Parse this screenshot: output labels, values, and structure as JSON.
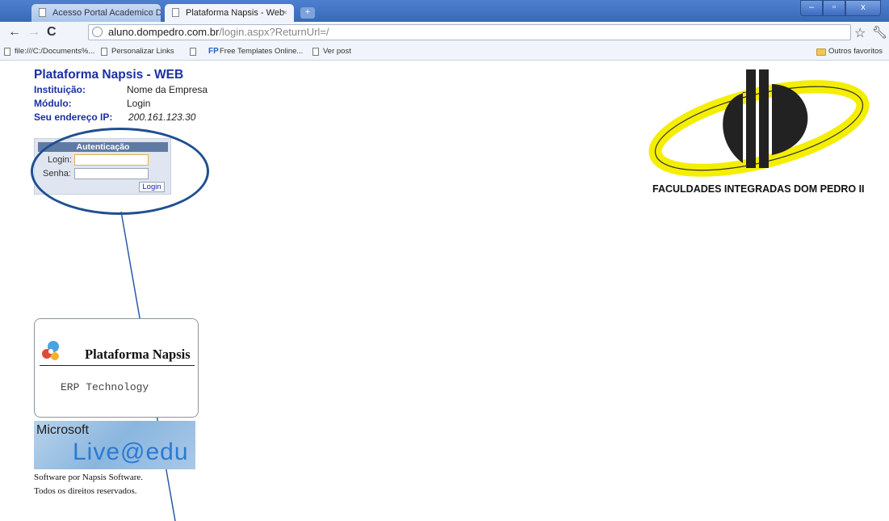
{
  "browser": {
    "tabs": [
      {
        "label": "Acesso Portal Academico D...",
        "close": "×"
      },
      {
        "label": "Plataforma Napsis - Web",
        "close": "×"
      }
    ],
    "new_tab": "+",
    "window_buttons": {
      "minimize": "–",
      "maximize": "▫",
      "close": "x"
    },
    "nav": {
      "back": "←",
      "forward": "→",
      "reload": "C"
    },
    "url": {
      "host": "aluno.dompedro.com.br",
      "path": "/login.aspx?ReturnUrl=/"
    },
    "bookmarks": [
      {
        "label": "file:///C:/Documents%..."
      },
      {
        "label": "Personalizar Links"
      },
      {
        "label": "Free Templates Online..."
      },
      {
        "label": "Ver post"
      }
    ],
    "other_bookmarks": "Outros favoritos"
  },
  "page": {
    "title": "Plataforma Napsis - WEB",
    "info": {
      "institution_label": "Instituição:",
      "institution_value": "Nome da Empresa",
      "module_label": "Módulo:",
      "module_value": "Login",
      "ip_label": "Seu endereço IP:",
      "ip_value": "200.161.123.30"
    },
    "auth": {
      "header": "Autenticação",
      "login_label": "Login:",
      "password_label": "Senha:",
      "login_value": "",
      "password_value": "",
      "button": "Login"
    },
    "napsis_badge": {
      "title": "Plataforma Napsis",
      "subtitle": "ERP Technology"
    },
    "live_badge": {
      "brand": "Microsoft",
      "product": "Live@edu"
    },
    "footer": {
      "line1": "Software por Napsis Software.",
      "line2": "Todos os direitos reservados."
    },
    "logo_caption": "FACULDADES INTEGRADAS DOM PEDRO II"
  },
  "colors": {
    "title_blue": "#1b2fa4",
    "annotation_ring": "#1f4f8f",
    "logo_yellow": "#f4ee00",
    "logo_dark": "#222222"
  }
}
